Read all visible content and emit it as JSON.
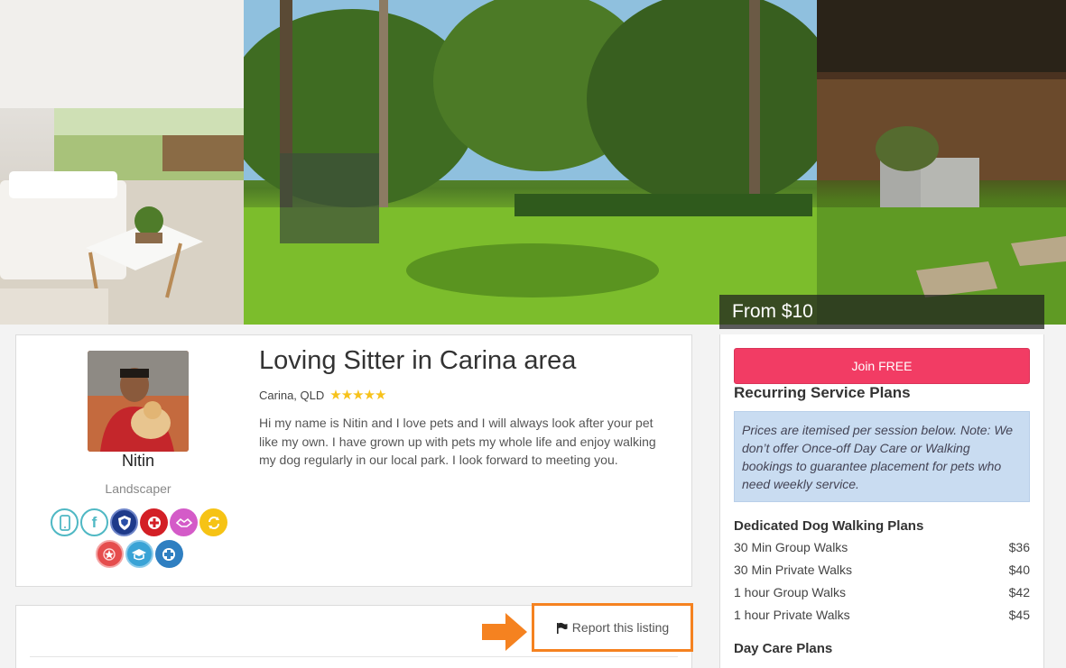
{
  "banner": {
    "price_from": "From $10"
  },
  "profile": {
    "name": "Nitin",
    "occupation": "Landscaper",
    "title": "Loving Sitter in Carina area",
    "location": "Carina, QLD",
    "rating_stars": "★★★★★",
    "rating_value": 5,
    "bio": "Hi my name is Nitin and I love pets and I will always look after your pet like my own. I have grown up with pets my whole life and enjoy walking my dog regularly in our local park. I look forward to meeting you.",
    "badges": [
      {
        "icon": "mobile-verified-icon",
        "color": "#4fb8c4"
      },
      {
        "icon": "facebook-verified-icon",
        "color": "#4fb8c4"
      },
      {
        "icon": "police-check-icon",
        "color": "#1e3a8a"
      },
      {
        "icon": "first-aid-icon",
        "color": "#d31f26"
      },
      {
        "icon": "handshake-icon",
        "color": "#d45bc8"
      },
      {
        "icon": "repeat-client-icon",
        "color": "#f6c315"
      },
      {
        "icon": "award-icon",
        "color": "#e54d4d"
      },
      {
        "icon": "trained-icon",
        "color": "#3aa3d6"
      },
      {
        "icon": "pet-first-aid-icon",
        "color": "#2f7fc1"
      }
    ]
  },
  "report": {
    "label": "Report this listing"
  },
  "sidebar": {
    "join_label": "Join FREE",
    "plans_title": "Recurring Service Plans",
    "notice": "Prices are itemised per session below. Note: We don’t offer Once-off Day Care or Walking bookings to guarantee placement for pets who need weekly service.",
    "walking_title": "Dedicated Dog Walking Plans",
    "walking_plans": [
      {
        "name": "30 Min Group Walks",
        "price": "$36"
      },
      {
        "name": "30 Min Private Walks",
        "price": "$40"
      },
      {
        "name": "1 hour Group Walks",
        "price": "$42"
      },
      {
        "name": "1 hour Private Walks",
        "price": "$45"
      }
    ],
    "daycare_title": "Day Care Plans"
  },
  "colors": {
    "accent_pink": "#f23c64",
    "highlight_orange": "#f58220",
    "notice_blue": "#c9dcf1",
    "star_gold": "#f7c21b"
  }
}
